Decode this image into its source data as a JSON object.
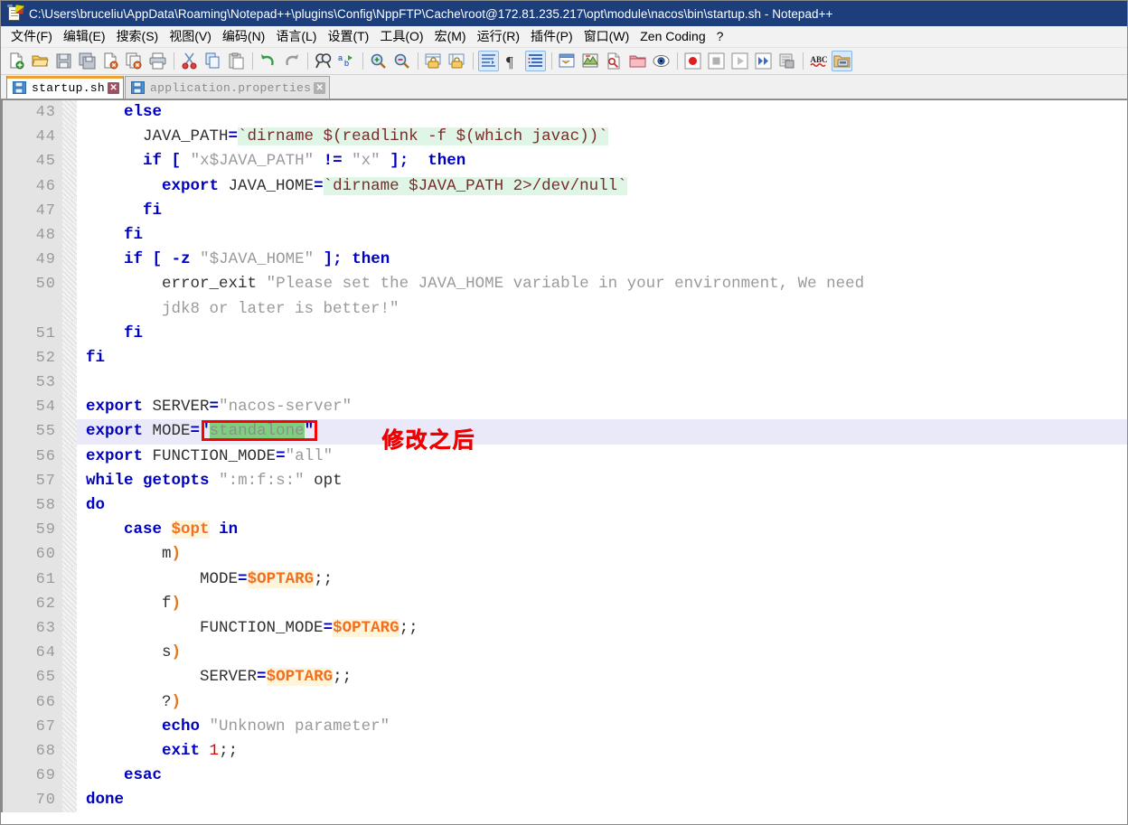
{
  "window": {
    "title": "C:\\Users\\bruceliu\\AppData\\Roaming\\Notepad++\\plugins\\Config\\NppFTP\\Cache\\root@172.81.235.217\\opt\\module\\nacos\\bin\\startup.sh - Notepad++",
    "app_icon": "notepad-plus-plus-icon",
    "titlebar_color": "#1c3f7c"
  },
  "menubar": {
    "items": [
      {
        "label": "文件(F)",
        "name": "menu-file"
      },
      {
        "label": "编辑(E)",
        "name": "menu-edit"
      },
      {
        "label": "搜索(S)",
        "name": "menu-search"
      },
      {
        "label": "视图(V)",
        "name": "menu-view"
      },
      {
        "label": "编码(N)",
        "name": "menu-encoding"
      },
      {
        "label": "语言(L)",
        "name": "menu-language"
      },
      {
        "label": "设置(T)",
        "name": "menu-settings"
      },
      {
        "label": "工具(O)",
        "name": "menu-tools"
      },
      {
        "label": "宏(M)",
        "name": "menu-macro"
      },
      {
        "label": "运行(R)",
        "name": "menu-run"
      },
      {
        "label": "插件(P)",
        "name": "menu-plugins"
      },
      {
        "label": "窗口(W)",
        "name": "menu-window"
      },
      {
        "label": "Zen Coding",
        "name": "menu-zen-coding"
      },
      {
        "label": "?",
        "name": "menu-help"
      }
    ]
  },
  "toolbar": {
    "buttons": [
      {
        "name": "new-file-icon",
        "group": 1
      },
      {
        "name": "open-file-icon",
        "group": 1
      },
      {
        "name": "save-icon",
        "group": 1
      },
      {
        "name": "save-all-icon",
        "group": 1
      },
      {
        "name": "close-file-icon",
        "group": 1
      },
      {
        "name": "close-all-files-icon",
        "group": 1
      },
      {
        "name": "print-icon",
        "group": 1
      },
      {
        "name": "cut-icon",
        "group": 2
      },
      {
        "name": "copy-icon",
        "group": 2
      },
      {
        "name": "paste-icon",
        "group": 2
      },
      {
        "name": "undo-icon",
        "group": 3
      },
      {
        "name": "redo-icon",
        "group": 3
      },
      {
        "name": "find-icon",
        "group": 4
      },
      {
        "name": "replace-icon",
        "group": 4
      },
      {
        "name": "zoom-in-icon",
        "group": 5
      },
      {
        "name": "zoom-out-icon",
        "group": 5
      },
      {
        "name": "sync-vertical-scroll-icon",
        "group": 6
      },
      {
        "name": "sync-horizontal-scroll-icon",
        "group": 6
      },
      {
        "name": "word-wrap-icon",
        "group": 7,
        "active": true
      },
      {
        "name": "show-all-characters-icon",
        "group": 7
      },
      {
        "name": "indent-guideline-icon",
        "group": 7,
        "active": true
      },
      {
        "name": "user-defined-dialog-icon",
        "group": 8
      },
      {
        "name": "document-map-icon",
        "group": 8
      },
      {
        "name": "function-list-icon",
        "group": 8
      },
      {
        "name": "folder-as-workspace-icon",
        "group": 8
      },
      {
        "name": "monitoring-icon",
        "group": 8
      },
      {
        "name": "macro-record-icon",
        "group": 9
      },
      {
        "name": "macro-stop-icon",
        "group": 9
      },
      {
        "name": "macro-play-icon",
        "group": 9
      },
      {
        "name": "macro-run-multiple-icon",
        "group": 9
      },
      {
        "name": "macro-save-icon",
        "group": 9
      },
      {
        "name": "spell-check-icon",
        "group": 10
      },
      {
        "name": "npp-ftp-icon",
        "group": 11,
        "active": true
      }
    ]
  },
  "tabs": [
    {
      "label": "startup.sh",
      "name": "tab-startup-sh",
      "active": true,
      "modified": false,
      "close_label": "✕"
    },
    {
      "label": "application.properties",
      "name": "tab-application-properties",
      "active": false,
      "modified": false,
      "close_label": "✕"
    }
  ],
  "editor": {
    "first_line": 43,
    "current_line": 55,
    "selection_text": "standalone",
    "lines": [
      {
        "n": 43,
        "tokens": [
          {
            "t": "    ",
            "c": "plain"
          },
          {
            "t": "else",
            "c": "kw"
          }
        ]
      },
      {
        "n": 44,
        "tokens": [
          {
            "t": "      ",
            "c": "plain"
          },
          {
            "t": "JAVA_PATH",
            "c": "plain"
          },
          {
            "t": "=",
            "c": "op"
          },
          {
            "t": "`dirname $(readlink -f $(which javac))`",
            "c": "bt"
          }
        ]
      },
      {
        "n": 45,
        "tokens": [
          {
            "t": "      ",
            "c": "plain"
          },
          {
            "t": "if",
            "c": "kw"
          },
          {
            "t": " ",
            "c": "plain"
          },
          {
            "t": "[",
            "c": "op"
          },
          {
            "t": " ",
            "c": "plain"
          },
          {
            "t": "\"x$JAVA_PATH\"",
            "c": "str"
          },
          {
            "t": " ",
            "c": "plain"
          },
          {
            "t": "!=",
            "c": "op"
          },
          {
            "t": " ",
            "c": "plain"
          },
          {
            "t": "\"x\"",
            "c": "str"
          },
          {
            "t": " ",
            "c": "plain"
          },
          {
            "t": "];",
            "c": "op"
          },
          {
            "t": "  ",
            "c": "plain"
          },
          {
            "t": "then",
            "c": "kw"
          }
        ]
      },
      {
        "n": 46,
        "tokens": [
          {
            "t": "        ",
            "c": "plain"
          },
          {
            "t": "export",
            "c": "kw"
          },
          {
            "t": " ",
            "c": "plain"
          },
          {
            "t": "JAVA_HOME",
            "c": "plain"
          },
          {
            "t": "=",
            "c": "op"
          },
          {
            "t": "`dirname $JAVA_PATH 2>/dev/null`",
            "c": "bt"
          }
        ]
      },
      {
        "n": 47,
        "tokens": [
          {
            "t": "      ",
            "c": "plain"
          },
          {
            "t": "fi",
            "c": "kw"
          }
        ]
      },
      {
        "n": 48,
        "tokens": [
          {
            "t": "    ",
            "c": "plain"
          },
          {
            "t": "fi",
            "c": "kw"
          }
        ]
      },
      {
        "n": 49,
        "tokens": [
          {
            "t": "    ",
            "c": "plain"
          },
          {
            "t": "if",
            "c": "kw"
          },
          {
            "t": " ",
            "c": "plain"
          },
          {
            "t": "[",
            "c": "op"
          },
          {
            "t": " ",
            "c": "plain"
          },
          {
            "t": "-z",
            "c": "kw"
          },
          {
            "t": " ",
            "c": "plain"
          },
          {
            "t": "\"$JAVA_HOME\"",
            "c": "str"
          },
          {
            "t": " ",
            "c": "plain"
          },
          {
            "t": "];",
            "c": "op"
          },
          {
            "t": " ",
            "c": "plain"
          },
          {
            "t": "then",
            "c": "kw"
          }
        ]
      },
      {
        "n": 50,
        "tokens": [
          {
            "t": "        ",
            "c": "plain"
          },
          {
            "t": "error_exit",
            "c": "plain"
          },
          {
            "t": " ",
            "c": "plain"
          },
          {
            "t": "\"Please set the JAVA_HOME variable in your environment, We need",
            "c": "str"
          }
        ]
      },
      {
        "n": null,
        "wrapped": true,
        "tokens": [
          {
            "t": "        ",
            "c": "plain"
          },
          {
            "t": "jdk8 or later is better!\"",
            "c": "str"
          }
        ]
      },
      {
        "n": 51,
        "tokens": [
          {
            "t": "    ",
            "c": "plain"
          },
          {
            "t": "fi",
            "c": "kw"
          }
        ]
      },
      {
        "n": 52,
        "tokens": [
          {
            "t": "fi",
            "c": "kw"
          }
        ]
      },
      {
        "n": 53,
        "tokens": []
      },
      {
        "n": 54,
        "tokens": [
          {
            "t": "export",
            "c": "kw"
          },
          {
            "t": " ",
            "c": "plain"
          },
          {
            "t": "SERVER",
            "c": "plain"
          },
          {
            "t": "=",
            "c": "op"
          },
          {
            "t": "\"nacos-server\"",
            "c": "str"
          }
        ]
      },
      {
        "n": 55,
        "current": true,
        "tokens": [
          {
            "t": "export",
            "c": "kw"
          },
          {
            "t": " ",
            "c": "plain"
          },
          {
            "t": "MODE",
            "c": "plain"
          },
          {
            "t": "=",
            "c": "op"
          },
          {
            "t": "\"",
            "c": "quot"
          },
          {
            "t": "standalone",
            "c": "sel"
          },
          {
            "t": "\"",
            "c": "quot"
          }
        ]
      },
      {
        "n": 56,
        "tokens": [
          {
            "t": "export",
            "c": "kw"
          },
          {
            "t": " ",
            "c": "plain"
          },
          {
            "t": "FUNCTION_MODE",
            "c": "plain"
          },
          {
            "t": "=",
            "c": "op"
          },
          {
            "t": "\"all\"",
            "c": "str"
          }
        ]
      },
      {
        "n": 57,
        "tokens": [
          {
            "t": "while",
            "c": "kw"
          },
          {
            "t": " ",
            "c": "plain"
          },
          {
            "t": "getopts",
            "c": "kw"
          },
          {
            "t": " ",
            "c": "plain"
          },
          {
            "t": "\":m:f:s:\"",
            "c": "str"
          },
          {
            "t": " ",
            "c": "plain"
          },
          {
            "t": "opt",
            "c": "plain"
          }
        ]
      },
      {
        "n": 58,
        "tokens": [
          {
            "t": "do",
            "c": "kw"
          }
        ]
      },
      {
        "n": 59,
        "tokens": [
          {
            "t": "    ",
            "c": "plain"
          },
          {
            "t": "case",
            "c": "kw"
          },
          {
            "t": " ",
            "c": "plain"
          },
          {
            "t": "$opt",
            "c": "var"
          },
          {
            "t": " ",
            "c": "plain"
          },
          {
            "t": "in",
            "c": "kw"
          }
        ]
      },
      {
        "n": 60,
        "tokens": [
          {
            "t": "        ",
            "c": "plain"
          },
          {
            "t": "m",
            "c": "plain"
          },
          {
            "t": ")",
            "c": "paren"
          }
        ]
      },
      {
        "n": 61,
        "tokens": [
          {
            "t": "            ",
            "c": "plain"
          },
          {
            "t": "MODE",
            "c": "plain"
          },
          {
            "t": "=",
            "c": "op"
          },
          {
            "t": "$OPTARG",
            "c": "var"
          },
          {
            "t": ";;",
            "c": "plain"
          }
        ]
      },
      {
        "n": 62,
        "tokens": [
          {
            "t": "        ",
            "c": "plain"
          },
          {
            "t": "f",
            "c": "plain"
          },
          {
            "t": ")",
            "c": "paren"
          }
        ]
      },
      {
        "n": 63,
        "tokens": [
          {
            "t": "            ",
            "c": "plain"
          },
          {
            "t": "FUNCTION_MODE",
            "c": "plain"
          },
          {
            "t": "=",
            "c": "op"
          },
          {
            "t": "$OPTARG",
            "c": "var"
          },
          {
            "t": ";;",
            "c": "plain"
          }
        ]
      },
      {
        "n": 64,
        "tokens": [
          {
            "t": "        ",
            "c": "plain"
          },
          {
            "t": "s",
            "c": "plain"
          },
          {
            "t": ")",
            "c": "paren"
          }
        ]
      },
      {
        "n": 65,
        "tokens": [
          {
            "t": "            ",
            "c": "plain"
          },
          {
            "t": "SERVER",
            "c": "plain"
          },
          {
            "t": "=",
            "c": "op"
          },
          {
            "t": "$OPTARG",
            "c": "var"
          },
          {
            "t": ";;",
            "c": "plain"
          }
        ]
      },
      {
        "n": 66,
        "tokens": [
          {
            "t": "        ",
            "c": "plain"
          },
          {
            "t": "?",
            "c": "plain"
          },
          {
            "t": ")",
            "c": "paren"
          }
        ]
      },
      {
        "n": 67,
        "tokens": [
          {
            "t": "        ",
            "c": "plain"
          },
          {
            "t": "echo",
            "c": "kw"
          },
          {
            "t": " ",
            "c": "plain"
          },
          {
            "t": "\"Unknown parameter\"",
            "c": "str"
          }
        ]
      },
      {
        "n": 68,
        "tokens": [
          {
            "t": "        ",
            "c": "plain"
          },
          {
            "t": "exit",
            "c": "kw"
          },
          {
            "t": " ",
            "c": "plain"
          },
          {
            "t": "1",
            "c": "num"
          },
          {
            "t": ";;",
            "c": "plain"
          }
        ]
      },
      {
        "n": 69,
        "tokens": [
          {
            "t": "    ",
            "c": "plain"
          },
          {
            "t": "esac",
            "c": "kw"
          }
        ]
      },
      {
        "n": 70,
        "tokens": [
          {
            "t": "done",
            "c": "kw"
          }
        ]
      }
    ]
  },
  "annotations": {
    "selection_box": {
      "name": "selection-highlight-box",
      "color": "#ff0000"
    },
    "note": {
      "text": "修改之后",
      "color": "#ee0000",
      "name": "annotation-label"
    }
  }
}
